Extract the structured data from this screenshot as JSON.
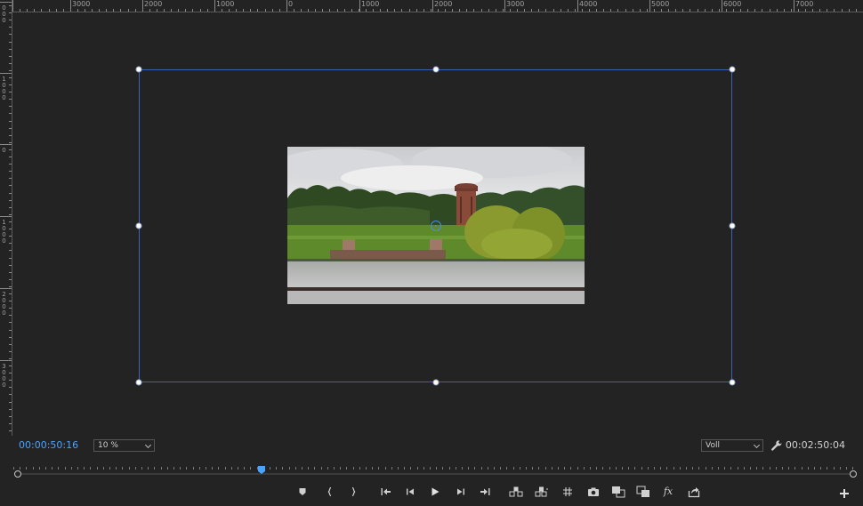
{
  "ruler": {
    "top_labels": [
      "3000",
      "2000",
      "1000",
      "0",
      "1000",
      "2000",
      "3000",
      "4000",
      "5000",
      "6000",
      "7000"
    ],
    "left_labels": [
      "000",
      "1000",
      "0",
      "1000",
      "2000",
      "3000"
    ]
  },
  "monitor": {
    "current_timecode": "00:00:50:16",
    "duration_timecode": "00:02:50:04",
    "zoom_level": "10 %",
    "playback_resolution": "Voll",
    "playhead_position": 0.295
  },
  "colors": {
    "accent": "#4aa3ff",
    "bounding_box": "#3b62b4",
    "background": "#232323"
  },
  "transport": {
    "buttons": [
      {
        "name": "add-marker-button",
        "icon": "marker-icon"
      },
      {
        "name": "mark-in-button",
        "icon": "mark-in-icon"
      },
      {
        "name": "mark-out-button",
        "icon": "mark-out-icon"
      },
      {
        "name": "go-to-in-button",
        "icon": "go-to-in-icon"
      },
      {
        "name": "step-back-button",
        "icon": "step-back-icon"
      },
      {
        "name": "play-button",
        "icon": "play-icon"
      },
      {
        "name": "step-forward-button",
        "icon": "step-forward-icon"
      },
      {
        "name": "go-to-out-button",
        "icon": "go-to-out-icon"
      },
      {
        "name": "lift-button",
        "icon": "lift-icon"
      },
      {
        "name": "extract-button",
        "icon": "extract-icon"
      },
      {
        "name": "safe-margins-button",
        "icon": "grid-icon"
      },
      {
        "name": "export-frame-button",
        "icon": "camera-icon"
      },
      {
        "name": "insert-button",
        "icon": "insert-icon"
      },
      {
        "name": "overwrite-button",
        "icon": "overwrite-icon"
      },
      {
        "name": "effects-button",
        "icon": "fx-icon"
      },
      {
        "name": "share-button",
        "icon": "share-icon"
      }
    ],
    "fx_label": "fx"
  }
}
